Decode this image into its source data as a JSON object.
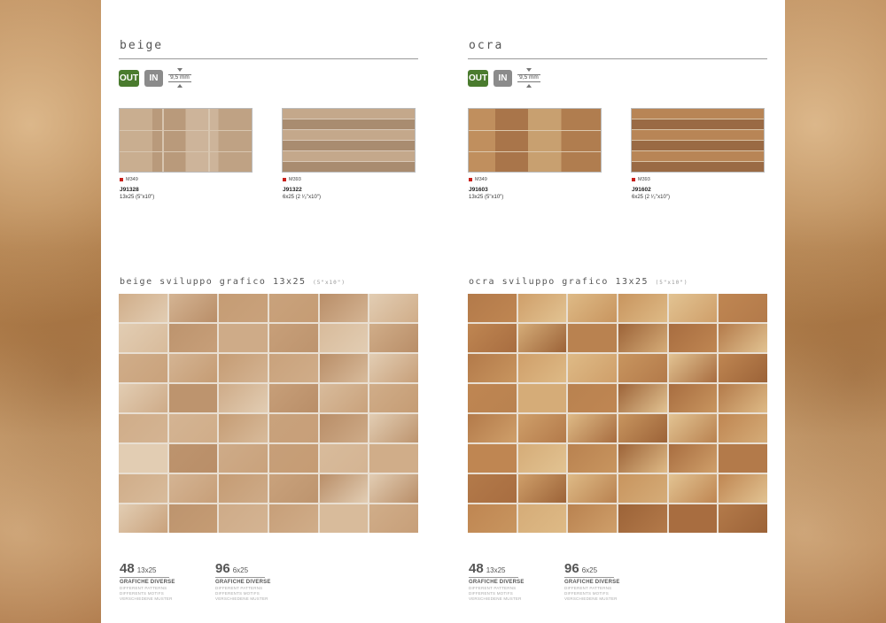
{
  "columns": [
    {
      "title": "beige",
      "badges": {
        "out": "OUT",
        "in": "IN"
      },
      "thickness": "9,5 mm",
      "tiles": [
        {
          "ref": "M349",
          "code": "J91328",
          "size": "13x25 (5\"x10\")"
        },
        {
          "ref": "M393",
          "code": "J91322",
          "size": "6x25 (2 ¹⁄₂\"x10\")"
        }
      ],
      "dev_title": "beige sviluppo grafico 13x25",
      "dev_size": "(5\"x10\")",
      "palette": [
        "#d0ad89",
        "#c9a27c",
        "#bd946e",
        "#d8bb9b",
        "#c59c74",
        "#e2cdb3",
        "#c79f79",
        "#d4b493",
        "#b98e68",
        "#ceab88"
      ],
      "stats": [
        {
          "num": "48",
          "fmt": "13x25",
          "label": "GRAFICHE DIVERSE",
          "l2": "DIFFERENT PATTERNS",
          "l3": "DIFFERENTS MOTIFS",
          "l4": "VERSCHIEDENE MUSTER"
        },
        {
          "num": "96",
          "fmt": "6x25",
          "label": "GRAFICHE DIVERSE",
          "l2": "DIFFERENT PATTERNS",
          "l3": "DIFFERENTS MOTIFS",
          "l4": "VERSCHIEDENE MUSTER"
        }
      ]
    },
    {
      "title": "ocra",
      "badges": {
        "out": "OUT",
        "in": "IN"
      },
      "thickness": "9,5 mm",
      "tiles": [
        {
          "ref": "M349",
          "code": "J91603",
          "size": "13x25 (5\"x10\")"
        },
        {
          "ref": "M393",
          "code": "J91602",
          "size": "6x25 (2 ¹⁄₂\"x10\")"
        }
      ],
      "dev_title": "ocra sviluppo grafico 13x25",
      "dev_size": "(5\"x10\")",
      "palette": [
        "#b37a4a",
        "#c8955f",
        "#d5ac78",
        "#a86d40",
        "#deba86",
        "#bf8652",
        "#9c6338",
        "#cf9f6a",
        "#e2c392",
        "#b98250"
      ],
      "stats": [
        {
          "num": "48",
          "fmt": "13x25",
          "label": "GRAFICHE DIVERSE",
          "l2": "DIFFERENT PATTERNS",
          "l3": "DIFFERENTS MOTIFS",
          "l4": "VERSCHIEDENE MUSTER"
        },
        {
          "num": "96",
          "fmt": "6x25",
          "label": "GRAFICHE DIVERSE",
          "l2": "DIFFERENT PATTERNS",
          "l3": "DIFFERENTS MOTIFS",
          "l4": "VERSCHIEDENE MUSTER"
        }
      ]
    }
  ]
}
